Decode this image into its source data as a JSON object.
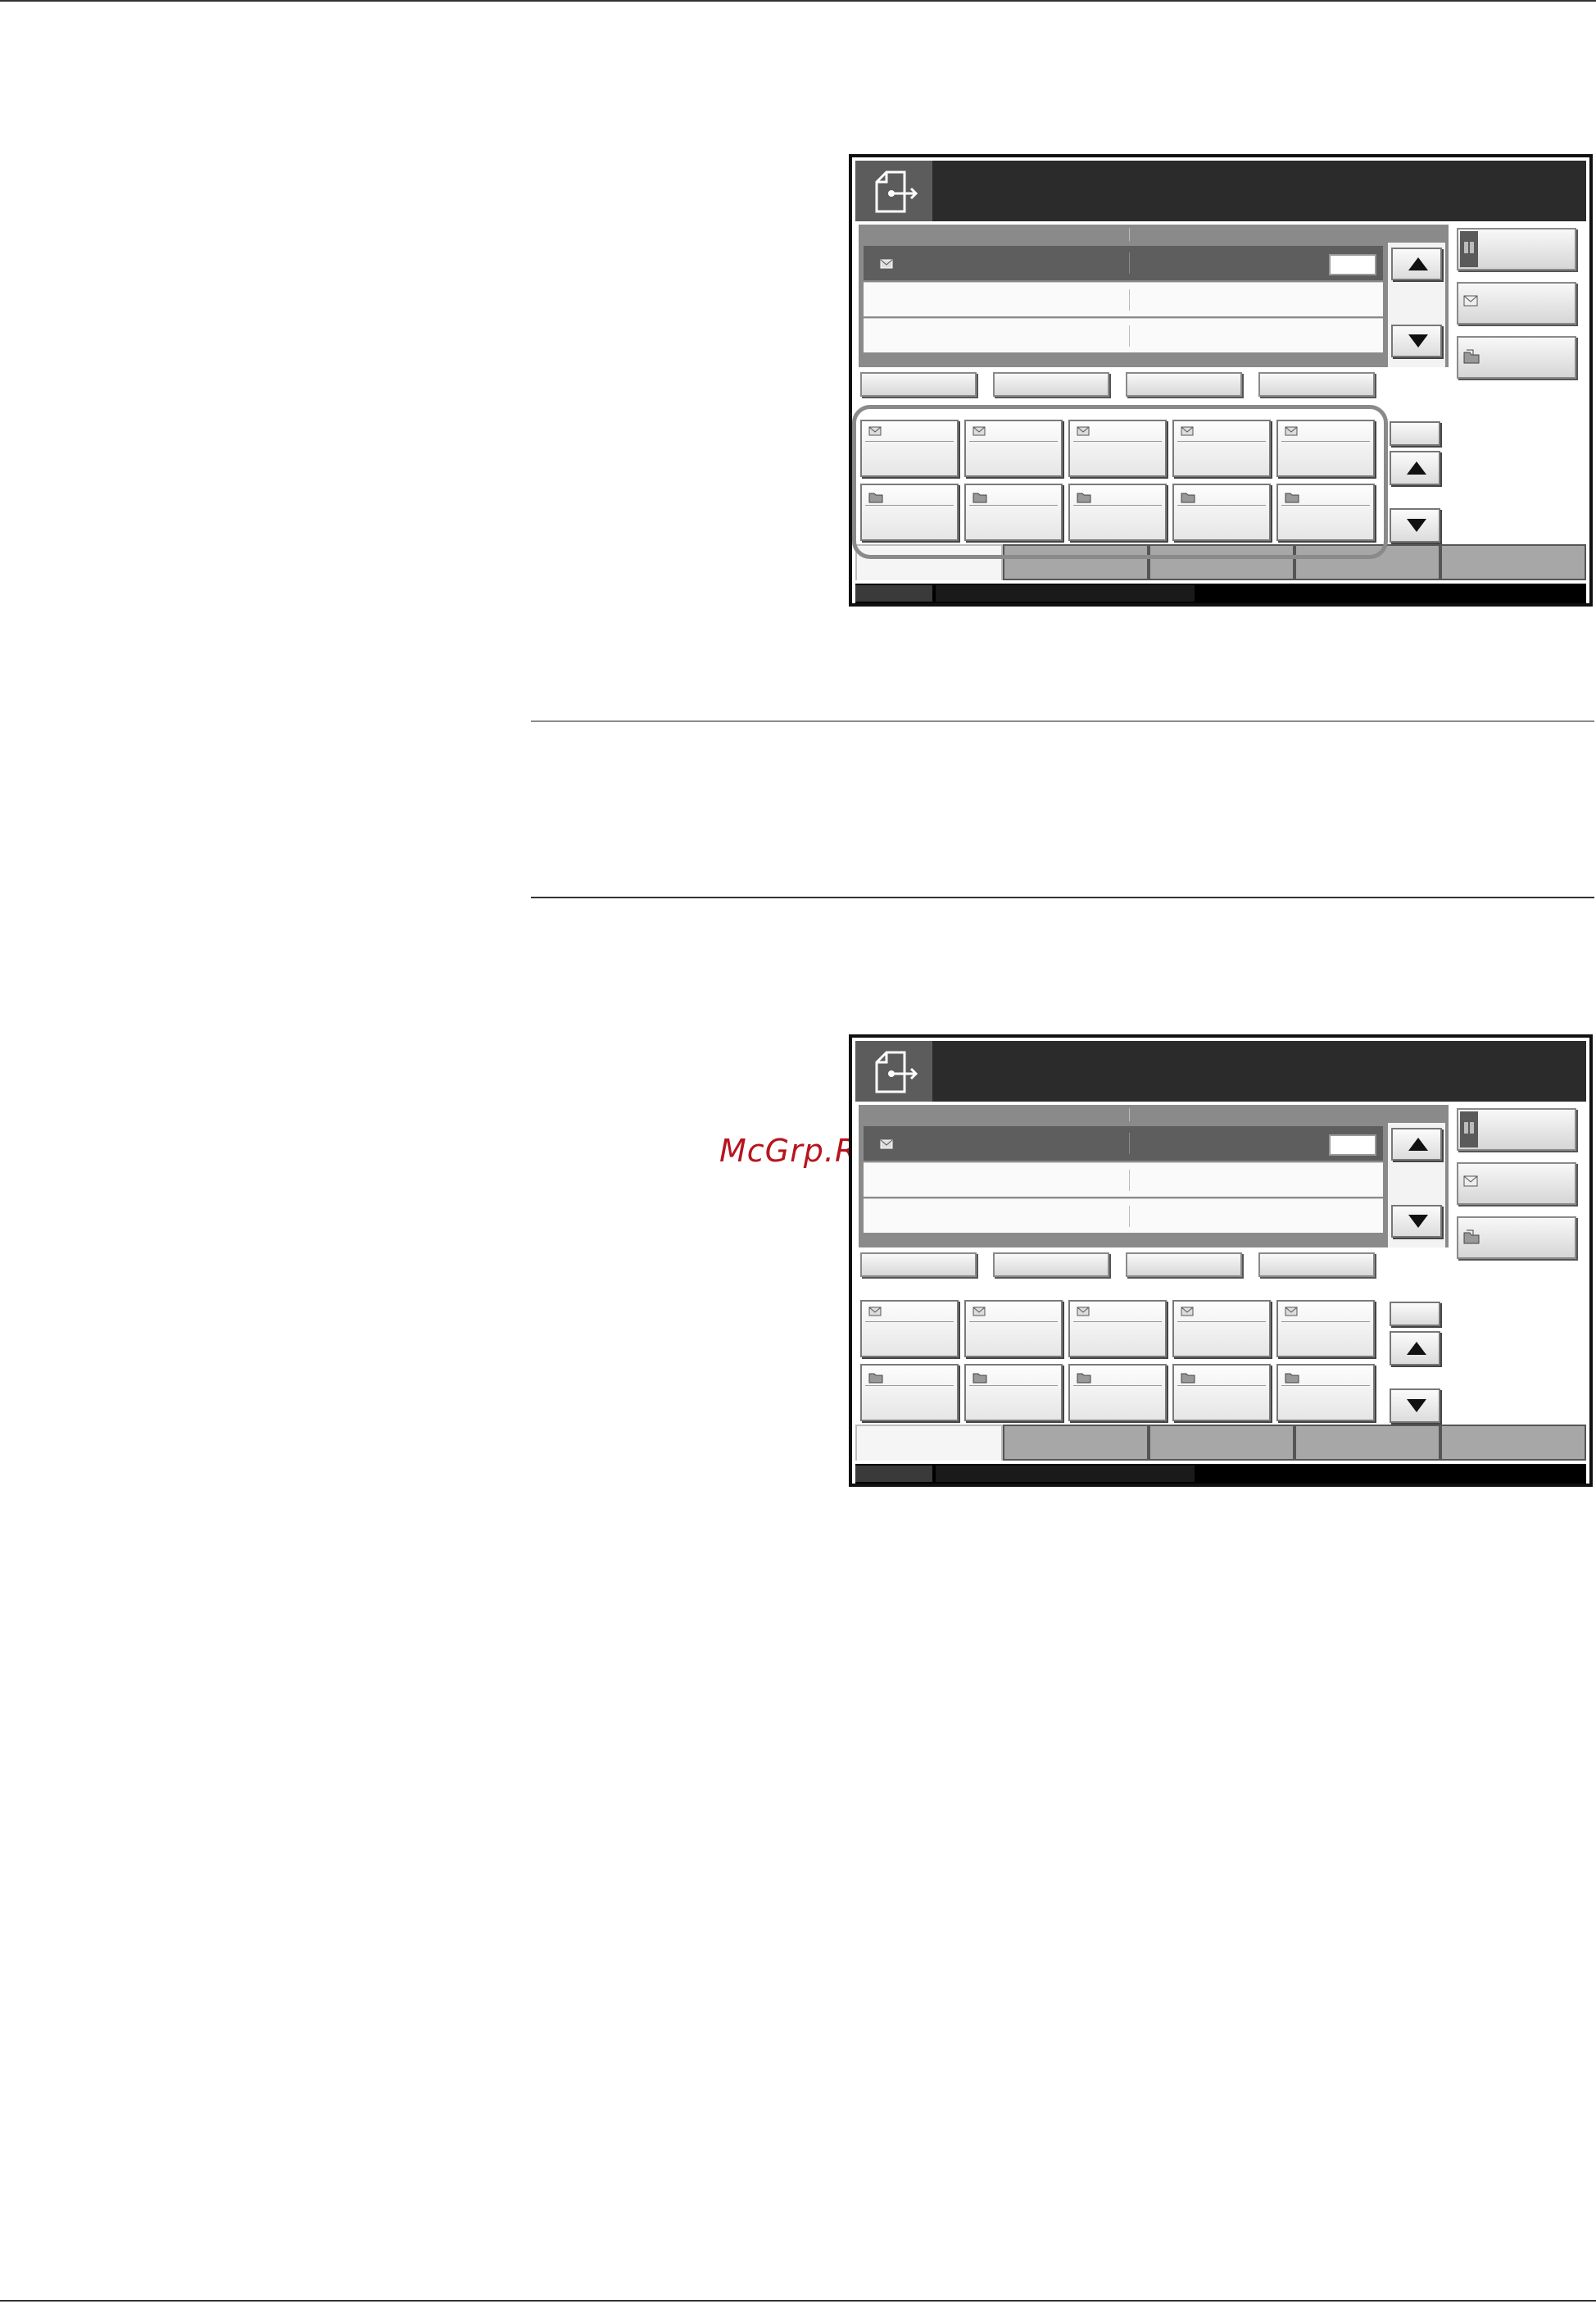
{
  "watermark": {
    "text": "McGrp.Ru"
  },
  "panels": [
    {
      "id": "panel-1",
      "onetouch_highlighted": true
    },
    {
      "id": "panel-2",
      "onetouch_highlighted": false
    }
  ],
  "icons": {
    "send": "send-document-icon",
    "address_book": "address-book-icon",
    "email": "email-icon",
    "folder": "folder-icon",
    "scroll_up": "triangle-up-icon",
    "scroll_down": "triangle-down-icon"
  },
  "colors": {
    "header": "#2b2b2b",
    "list_area": "#8a8a8a",
    "selected_row": "#5e5e5e",
    "callout": "#8a8a8a",
    "watermark": "#b8141e"
  }
}
